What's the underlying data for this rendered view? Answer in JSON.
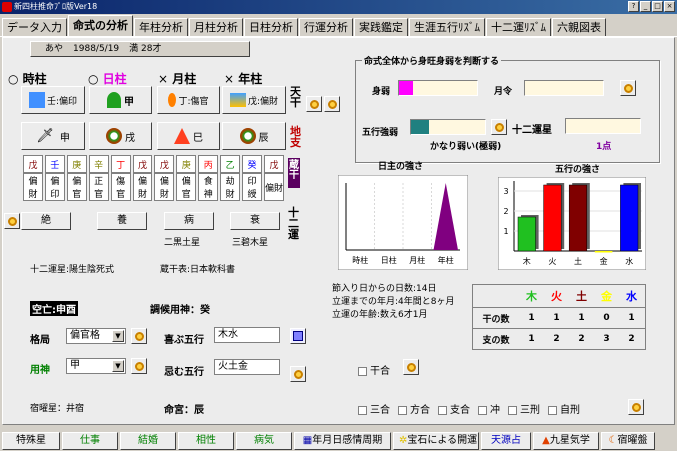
{
  "window": {
    "title": "新四柱推命ﾌﾟﾛ版Ver18",
    "btns": [
      "?",
      "_",
      "□",
      "×"
    ]
  },
  "tabs": [
    "データ入力",
    "命式の分析",
    "年柱分析",
    "月柱分析",
    "日柱分析",
    "行運分析",
    "実践鑑定",
    "生涯五行ﾘｽﾞﾑ",
    "十二運ﾘｽﾞﾑ",
    "六親図表"
  ],
  "person": {
    "name": "あや",
    "birth": "1988/5/19",
    "age": "満 28才"
  },
  "pillars": {
    "labels": [
      "時柱",
      "日柱",
      "月柱",
      "年柱"
    ],
    "marks": [
      "○",
      "○",
      "×",
      "×"
    ],
    "tenkan": [
      "壬:偏印",
      "甲",
      "丁:傷官",
      "戊:偏財"
    ],
    "chishi": [
      "申",
      "戌",
      "巳",
      "辰"
    ],
    "zoukan": [
      [
        "戊",
        "壬",
        "庚"
      ],
      [
        "辛",
        "丁",
        "戊"
      ],
      [
        "戊",
        "庚",
        "丙"
      ],
      [
        "乙",
        "癸",
        "戊"
      ]
    ],
    "zoukan_star": [
      [
        "偏財",
        "偏印",
        "偏官"
      ],
      [
        "正官",
        "傷官",
        "偏財"
      ],
      [
        "偏財",
        "偏官",
        "食神"
      ],
      [
        "劫財",
        "印綬",
        "偏財"
      ]
    ],
    "unsei": [
      "絶",
      "養",
      "病",
      "衰"
    ],
    "kyusei": [
      "",
      "",
      "二黒土星",
      "三碧木星"
    ]
  },
  "side_labels": {
    "ten": "天干",
    "chi": "地支",
    "zou": "蔵干",
    "jun": "十二運"
  },
  "info": {
    "junisei": "十二運星:陽生陰死式",
    "kansetu": "蔵干表:日本軟科書",
    "kuubou": "空亡:申酉",
    "choko": "調候用神：癸",
    "kakkyoku_label": "格局",
    "kakkyoku": "偏官格",
    "yoshin_label": "用神",
    "yoshin": "甲",
    "yorokobu_label": "喜ぶ五行",
    "yorokobu": "木水",
    "imu_label": "忌む五行",
    "imu": "火土金",
    "shukusei": "宿曜星：井宿",
    "meigu": "命宮：辰"
  },
  "strength": {
    "title": "命式全体から身旺身弱を判断する",
    "mijaku": "身弱",
    "gatsurei": "月令",
    "gogyo_label": "五行強弱",
    "junisei_label": "十二運星",
    "verdict": "かなり弱い(極弱)",
    "points": "1点"
  },
  "charts": {
    "left_title": "日主の強さ",
    "right_title": "五行の強さ"
  },
  "chart_data": [
    {
      "type": "area",
      "title": "日主の強さ",
      "categories": [
        "時柱",
        "日柱",
        "月柱",
        "年柱"
      ],
      "values": [
        0,
        0,
        0,
        1
      ]
    },
    {
      "type": "bar",
      "title": "五行の強さ",
      "categories": [
        "木",
        "火",
        "土",
        "金",
        "水"
      ],
      "values": [
        1.7,
        3.3,
        3.3,
        0,
        3.3
      ],
      "yticks": [
        "1",
        "2",
        "3"
      ],
      "ylim": [
        0,
        3.5
      ],
      "colors": [
        "#20c020",
        "#ff0000",
        "#800000",
        "#ffff00",
        "#0000ff"
      ]
    }
  ],
  "birthinfo": [
    "節入り日からの日数:14日",
    "立運までの年月:4年間と8ヶ月",
    "立運の年齢:数え6才1月"
  ],
  "table": {
    "headers": [
      "",
      "木",
      "火",
      "土",
      "金",
      "水"
    ],
    "rows": [
      {
        "label": "干の数",
        "vals": [
          "1",
          "1",
          "1",
          "0",
          "1"
        ]
      },
      {
        "label": "支の数",
        "vals": [
          "1",
          "2",
          "2",
          "3",
          "2"
        ]
      }
    ]
  },
  "checks": {
    "kango": "干合",
    "others": [
      "三合",
      "方合",
      "支合",
      "冲",
      "三刑",
      "自刑"
    ]
  },
  "bottom": [
    "特殊星",
    "仕事",
    "結婚",
    "相性",
    "病気",
    "年月日感情周期",
    "宝石による開運",
    "天源占",
    "九星気学",
    "宿曜盤"
  ]
}
